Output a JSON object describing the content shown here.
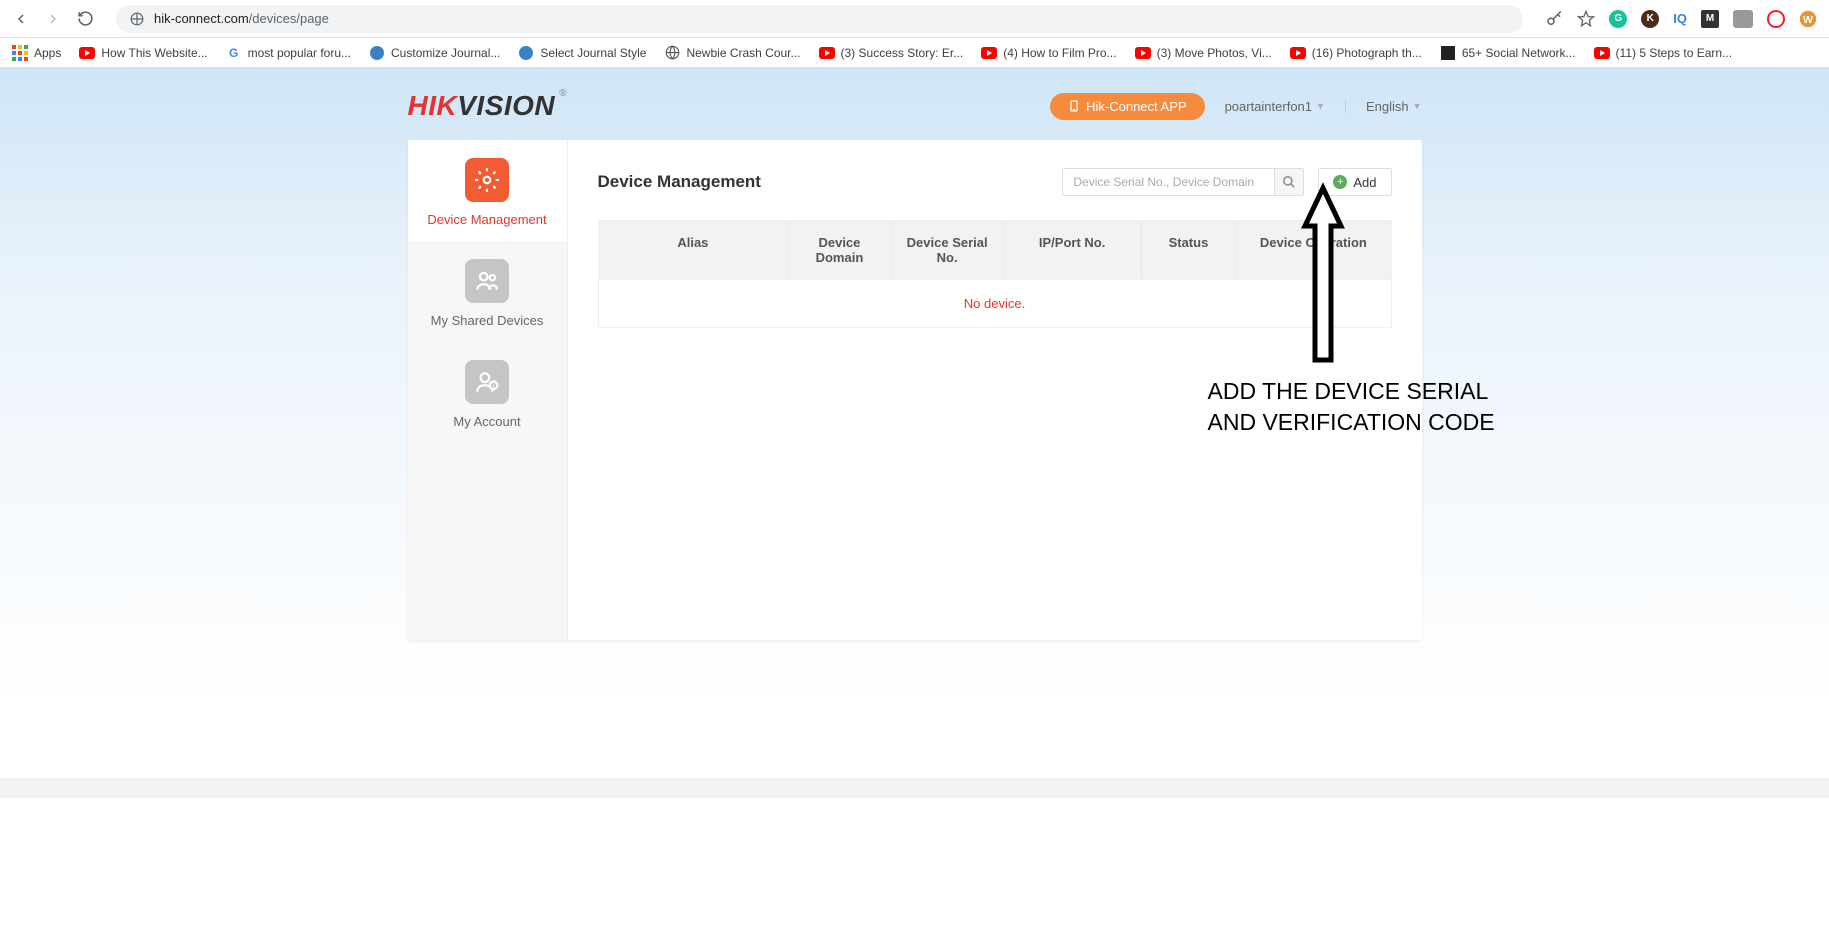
{
  "browser": {
    "url_prefix": "hik-connect.com",
    "url_path": "/devices/page"
  },
  "bookmarks": [
    {
      "label": "Apps",
      "type": "apps"
    },
    {
      "label": "How This Website...",
      "type": "yt"
    },
    {
      "label": "most popular foru...",
      "type": "g"
    },
    {
      "label": "Customize Journal...",
      "type": "blue"
    },
    {
      "label": "Select Journal Style",
      "type": "blue"
    },
    {
      "label": "Newbie Crash Cour...",
      "type": "globe"
    },
    {
      "label": "(3) Success Story: Er...",
      "type": "yt"
    },
    {
      "label": "(4) How to Film Pro...",
      "type": "yt"
    },
    {
      "label": "(3) Move Photos, Vi...",
      "type": "yt"
    },
    {
      "label": "(16) Photograph th...",
      "type": "yt"
    },
    {
      "label": "65+ Social Network...",
      "type": "dark"
    },
    {
      "label": "(11) 5 Steps to Earn...",
      "type": "yt"
    }
  ],
  "logo": {
    "part1": "HIK",
    "part2": "VISION"
  },
  "header": {
    "app_button": "Hik-Connect APP",
    "username": "poartainterfon1",
    "language": "English"
  },
  "sidebar": {
    "items": [
      {
        "label": "Device Management",
        "active": true
      },
      {
        "label": "My Shared Devices",
        "active": false
      },
      {
        "label": "My Account",
        "active": false
      }
    ]
  },
  "content": {
    "title": "Device Management",
    "search_placeholder": "Device Serial No., Device Domain",
    "add_label": "Add",
    "columns": {
      "alias": "Alias",
      "domain": "Device Domain",
      "serial": "Device Serial No.",
      "ip": "IP/Port No.",
      "status": "Status",
      "operation": "Device Operation"
    },
    "empty_message": "No device."
  },
  "annotation": {
    "line1": "Add the device serial",
    "line2": "and verification code"
  }
}
